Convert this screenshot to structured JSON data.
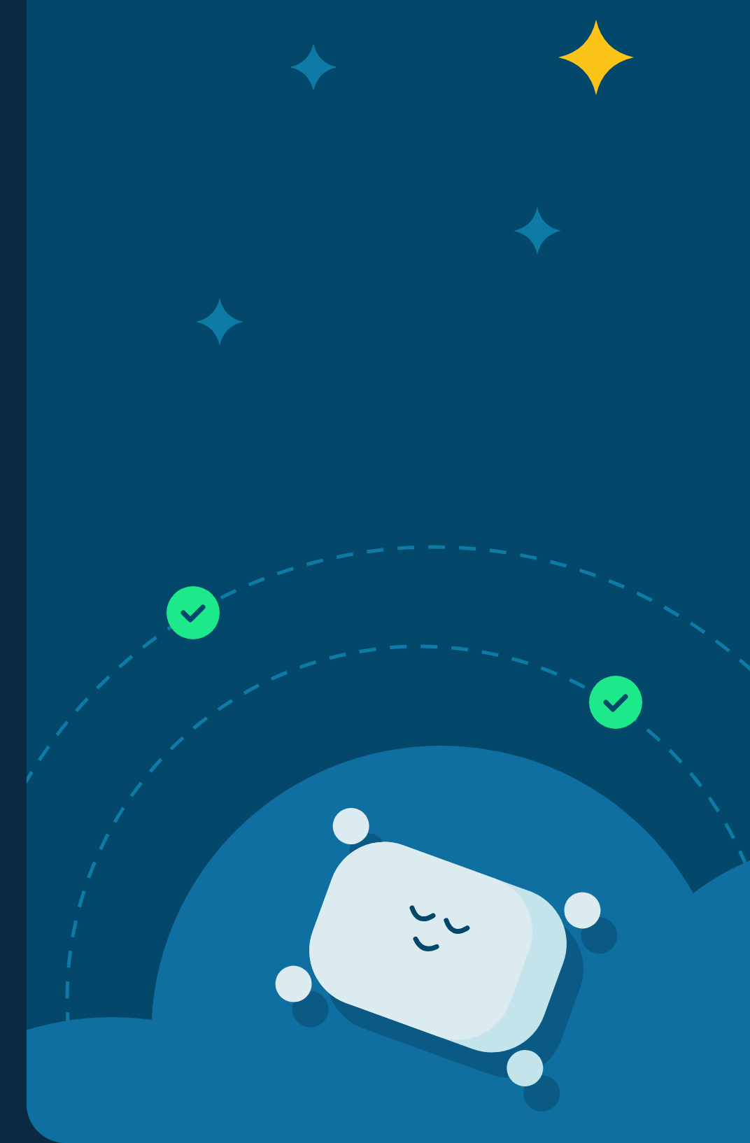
{
  "progress_markers": [
    {
      "checked": true
    },
    {
      "checked": true
    }
  ]
}
